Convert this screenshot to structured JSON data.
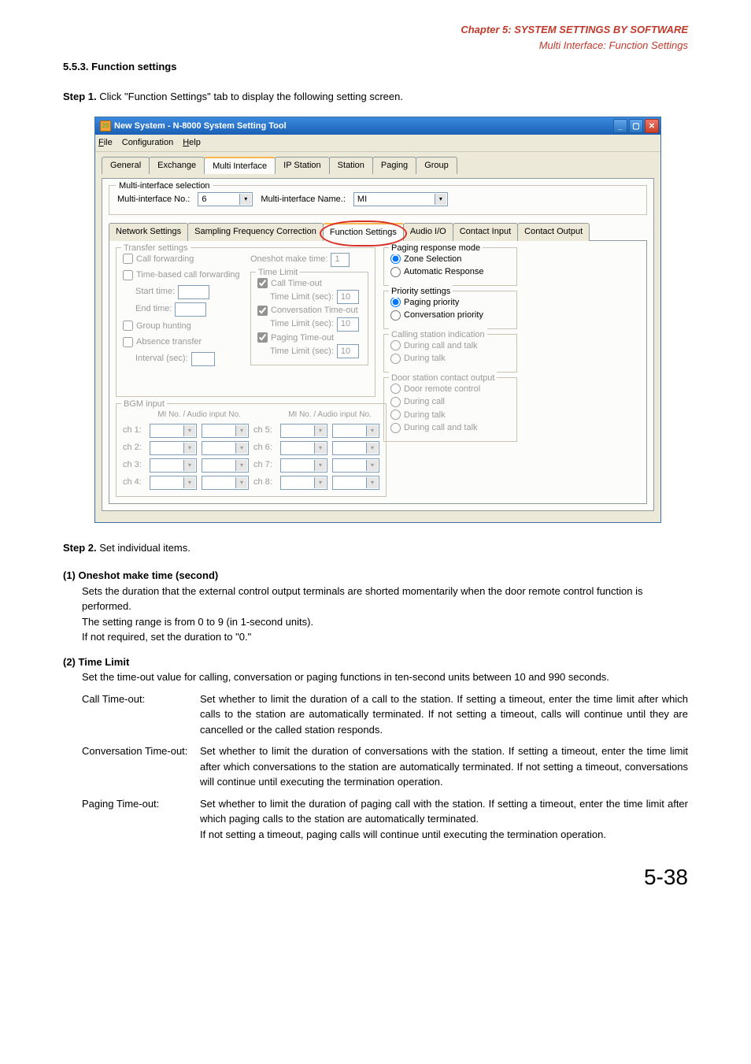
{
  "header": {
    "chapter": "Chapter 5:  SYSTEM SETTINGS BY SOFTWARE",
    "section": "Multi Interface: Function Settings"
  },
  "heading": "5.5.3. Function settings",
  "step1_label": "Step 1.",
  "step1_text": "Click \"Function Settings\" tab to display the following setting screen.",
  "window": {
    "title": "New System - N-8000 System Setting Tool",
    "menu": {
      "file": "File",
      "config": "Configuration",
      "help": "Help"
    },
    "tabs": {
      "general": "General",
      "exchange": "Exchange",
      "multi": "Multi Interface",
      "ip": "IP Station",
      "station": "Station",
      "paging": "Paging",
      "group": "Group"
    },
    "mi_sel_legend": "Multi-interface selection",
    "mi_no_label": "Multi-interface No.:",
    "mi_no_value": "6",
    "mi_name_label": "Multi-interface Name.:",
    "mi_name_value": "MI",
    "subtabs": {
      "net": "Network Settings",
      "sfc": "Sampling Frequency Correction",
      "func": "Function Settings",
      "audio": "Audio I/O",
      "cin": "Contact Input",
      "cout": "Contact Output"
    },
    "transfer": {
      "legend": "Transfer settings",
      "call_fwd": "Call forwarding",
      "time_based": "Time-based call forwarding",
      "start": "Start time:",
      "end": "End time:",
      "group_hunt": "Group hunting",
      "absence": "Absence transfer",
      "interval": "Interval (sec):"
    },
    "oneshot_label": "Oneshot make time:",
    "oneshot_value": "1",
    "timelimit": {
      "legend": "Time Limit",
      "call_to": "Call Time-out",
      "tl": "Time Limit (sec):",
      "conv_to": "Conversation Time-out",
      "page_to": "Paging Time-out",
      "v1": "10",
      "v2": "10",
      "v3": "10"
    },
    "paging_mode": {
      "legend": "Paging response mode",
      "zone": "Zone Selection",
      "auto": "Automatic Response"
    },
    "priority": {
      "legend": "Priority settings",
      "page": "Paging priority",
      "conv": "Conversation priority"
    },
    "calling_ind": {
      "legend": "Calling station indication",
      "dct": "During call and talk",
      "dt": "During talk"
    },
    "bgm": {
      "legend": "BGM input",
      "hdr": "MI No. / Audio input No.",
      "ch": [
        "ch 1:",
        "ch 2:",
        "ch 3:",
        "ch 4:",
        "ch 5:",
        "ch 6:",
        "ch 7:",
        "ch 8:"
      ]
    },
    "door": {
      "legend": "Door station contact output",
      "drc": "Door remote control",
      "dc": "During call",
      "dt": "During talk",
      "dct": "During call and talk"
    }
  },
  "step2_label": "Step 2.",
  "step2_text": "Set individual items.",
  "item1_hd": "(1)  Oneshot make time (second)",
  "item1_p1": "Sets the duration that the external control output terminals are shorted momentarily when the door remote control function is performed.",
  "item1_p2": "The setting range is from 0 to 9 (in 1-second units).",
  "item1_p3": "If not required, set the duration to \"0.\"",
  "item2_hd": "(2)  Time Limit",
  "item2_intro": "Set the time-out value for calling, conversation or paging functions in ten-second units between 10 and 990 seconds.",
  "defs": {
    "cto_label": "Call Time-out:",
    "cto_body": "Set whether to limit the duration of a call to the station. If setting a timeout, enter the time limit after which calls to the station are automatically terminated. If not setting a timeout, calls will continue until they are cancelled or the called station responds.",
    "convto_label": "Conversation Time-out:",
    "convto_body": "Set whether to limit the duration of conversations with the station. If setting a timeout, enter the time limit after which conversations to the station are automatically terminated. If not setting a timeout, conversations will continue until executing the termination operation.",
    "pto_label": "Paging Time-out:",
    "pto_body1": "Set whether to limit the duration of paging call with the station. If setting a timeout, enter the time limit after which paging calls to the station are automatically terminated.",
    "pto_body2": "If not setting a timeout, paging calls will continue until executing the termination operation."
  },
  "page_number": "5-38"
}
